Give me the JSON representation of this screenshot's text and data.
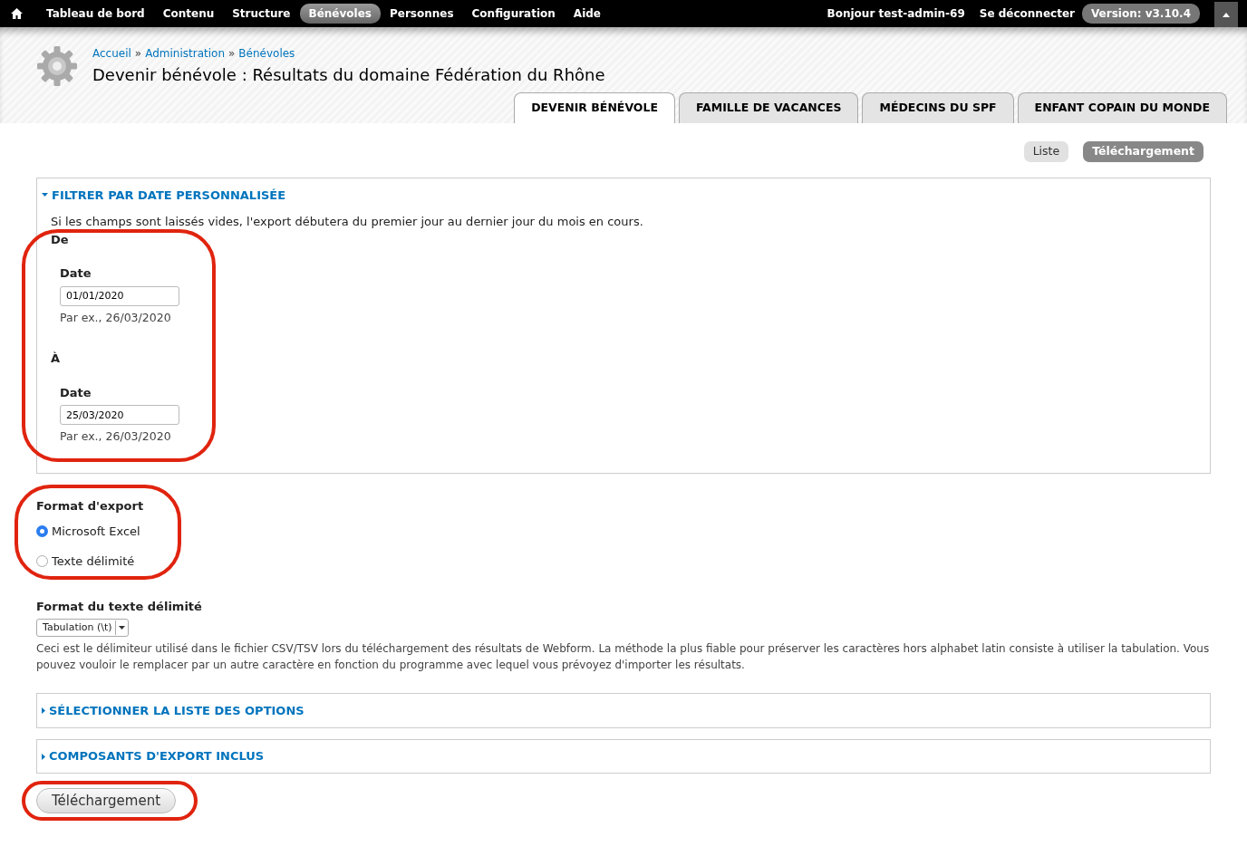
{
  "toolbar": {
    "menu": [
      {
        "label": "Tableau de bord",
        "selected": false
      },
      {
        "label": "Contenu",
        "selected": false
      },
      {
        "label": "Structure",
        "selected": false
      },
      {
        "label": "Bénévoles",
        "selected": true
      },
      {
        "label": "Personnes",
        "selected": false
      },
      {
        "label": "Configuration",
        "selected": false
      },
      {
        "label": "Aide",
        "selected": false
      }
    ],
    "greeting": "Bonjour",
    "username": "test-admin-69",
    "logout": "Se déconnecter",
    "version": "Version: v3.10.4"
  },
  "breadcrumb": [
    {
      "label": "Accueil"
    },
    {
      "separator": "»",
      "label": "Administration"
    },
    {
      "separator": "»",
      "label": "Bénévoles"
    }
  ],
  "page_title": "Devenir bénévole : Résultats du domaine Fédération du Rhône",
  "tabs": [
    {
      "label": "DEVENIR BÉNÉVOLE",
      "selected": true
    },
    {
      "label": "FAMILLE DE VACANCES",
      "selected": false
    },
    {
      "label": "MÉDECINS DU SPF",
      "selected": false
    },
    {
      "label": "ENFANT COPAIN DU MONDE",
      "selected": false
    }
  ],
  "secondary_tabs": [
    {
      "label": "Liste",
      "selected": false
    },
    {
      "label": "Téléchargement",
      "selected": true
    }
  ],
  "date_filter": {
    "legend": "FILTRER PAR DATE PERSONNALISÉE",
    "expanded": true,
    "description": "Si les champs sont laissés vides, l'export débutera du premier jour au dernier jour du mois en cours.",
    "circled": true,
    "ranges": [
      {
        "heading": "De",
        "label": "Date",
        "value": "01/01/2020",
        "hint": "Par ex., 26/03/2020"
      },
      {
        "heading": "À",
        "label": "Date",
        "value": "25/03/2020",
        "hint": "Par ex., 26/03/2020"
      }
    ]
  },
  "export_format": {
    "label": "Format d'export",
    "circled": true,
    "options": [
      {
        "label": "Microsoft Excel",
        "selected": true
      },
      {
        "label": "Texte délimité",
        "selected": false
      }
    ]
  },
  "delimiter": {
    "label": "Format du texte délimité",
    "value": "Tabulation (\\t)",
    "description": "Ceci est le délimiteur utilisé dans le fichier CSV/TSV lors du téléchargement des résultats de Webform. La méthode la plus fiable pour préserver les caractères hors alphabet latin consiste à utiliser la tabulation. Vous pouvez vouloir le remplacer par un autre caractère en fonction du programme avec lequel vous prévoyez d'importer les résultats."
  },
  "collapsed_sections": [
    {
      "legend": "SÉLECTIONNER LA LISTE DES OPTIONS",
      "expanded": false
    },
    {
      "legend": "COMPOSANTS D'EXPORT INCLUS",
      "expanded": false
    }
  ],
  "submit": {
    "label": "Téléchargement",
    "circled": true
  }
}
